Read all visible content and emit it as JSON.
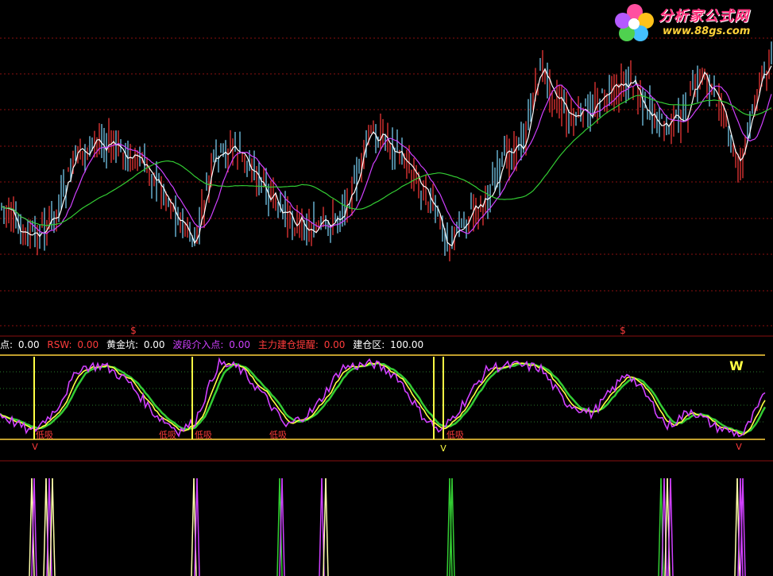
{
  "logo": {
    "title": "分析家公式网",
    "url": "www.88gs.com"
  },
  "legend": [
    {
      "label": "点:",
      "value": "0.00",
      "color": "#ffffff"
    },
    {
      "label": "RSW:",
      "value": "0.00",
      "color": "#ff3b3b"
    },
    {
      "label": "黄金坑:",
      "value": "0.00",
      "color": "#ffffff"
    },
    {
      "label": "波段介入点:",
      "value": "0.00",
      "color": "#d040ff"
    },
    {
      "label": "主力建仓提醒:",
      "value": "0.00",
      "color": "#ff3b3b"
    },
    {
      "label": "建仓区:",
      "value": "100.00",
      "color": "#ffffff"
    }
  ],
  "markers": {
    "dollar": "$",
    "buy": "低吸",
    "w": "W",
    "v": "V"
  },
  "chart_data": [
    {
      "type": "candlestick",
      "series": [
        {
          "name": "",
          "color": "#ffffff",
          "role": "close"
        },
        {
          "name": "",
          "color": "#d040ff",
          "role": "ma-mid"
        },
        {
          "name": "",
          "color": "#33cc33",
          "role": "ma-long"
        }
      ],
      "candle_colors": {
        "up": "#ff3b3b",
        "down": "#7fd8ff"
      },
      "grid": true,
      "grid_color": "#8a1010"
    },
    {
      "type": "line",
      "ylim": [
        0,
        100
      ],
      "series": [
        {
          "name": "",
          "color": "#d040ff"
        },
        {
          "name": "",
          "color": "#ffff44"
        },
        {
          "name": "",
          "color": "#33cc33"
        }
      ],
      "reference_lines": [
        {
          "value": 100,
          "color": "#ffd23a"
        },
        {
          "value": 0,
          "color": "#ffd23a"
        }
      ],
      "grid": true
    },
    {
      "type": "bar",
      "signals": [
        {
          "color": "#ffffaa"
        },
        {
          "color": "#d040ff"
        },
        {
          "color": "#ffffaa"
        },
        {
          "color": "#33cc33"
        },
        {
          "color": "#d040ff"
        },
        {
          "color": "#33cc33"
        },
        {
          "color": "#ffffaa"
        },
        {
          "color": "#d040ff"
        }
      ]
    }
  ]
}
